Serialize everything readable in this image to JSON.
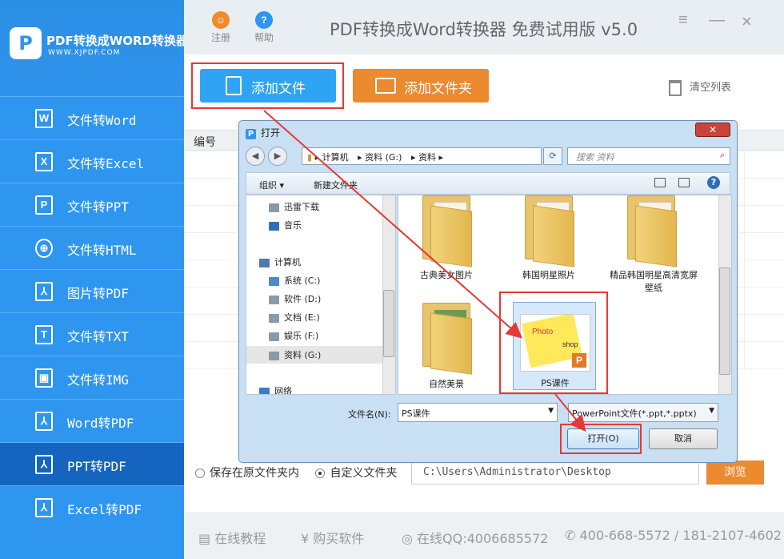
{
  "sidebar": {
    "logo_glyph": "P",
    "title": "PDF转换成WORD转换器",
    "subtitle": "WWW.XJPDF.COM",
    "items": [
      {
        "label": "文件转Word",
        "icon": "word-icon",
        "glyph": "W"
      },
      {
        "label": "文件转Excel",
        "icon": "excel-icon",
        "glyph": "X"
      },
      {
        "label": "文件转PPT",
        "icon": "ppt-icon",
        "glyph": "P"
      },
      {
        "label": "文件转HTML",
        "icon": "globe-icon",
        "glyph": "⊕"
      },
      {
        "label": "图片转PDF",
        "icon": "pdf-icon",
        "glyph": "⅄"
      },
      {
        "label": "文件转TXT",
        "icon": "txt-icon",
        "glyph": "T"
      },
      {
        "label": "文件转IMG",
        "icon": "image-icon",
        "glyph": "▣"
      },
      {
        "label": "Word转PDF",
        "icon": "pdf-icon",
        "glyph": "⅄"
      },
      {
        "label": "PPT转PDF",
        "icon": "pdf-icon",
        "glyph": "⅄"
      },
      {
        "label": "Excel转PDF",
        "icon": "pdf-icon",
        "glyph": "⅄"
      }
    ],
    "active_item": "PPT转PDF"
  },
  "topbar": {
    "register_label": "注册",
    "help_label": "帮助",
    "title": "PDF转换成Word转换器 免费试用版 v5.0",
    "minimize": "≡",
    "dash": "—",
    "close": "×"
  },
  "toolbar": {
    "add_file": "添加文件",
    "add_folder": "添加文件夹",
    "clear_list": "清空列表"
  },
  "table": {
    "col_no": "编号"
  },
  "output": {
    "option_source": "保存在原文件夹内",
    "option_custom": "自定义文件夹",
    "selected": "自定义文件夹",
    "path": "C:\\Users\\Administrator\\Desktop",
    "browse": "浏览"
  },
  "footer": {
    "tutorial": "在线教程",
    "buy": "购买软件",
    "qq": "在线QQ:4006685572",
    "phone": "400-668-5572 / 181-2107-4602"
  },
  "dialog": {
    "title": "打开",
    "close": "✕",
    "address": [
      "计算机",
      "资料 (G:)",
      "资料"
    ],
    "search_placeholder": "搜索 资料",
    "organize": "组织",
    "new_folder": "新建文件夹",
    "nav_items": [
      {
        "label": "迅雷下载",
        "indent": 1
      },
      {
        "label": "音乐",
        "indent": 1
      },
      {
        "label": "计算机",
        "indent": 0
      },
      {
        "label": "系统 (C:)",
        "indent": 1
      },
      {
        "label": "软件 (D:)",
        "indent": 1
      },
      {
        "label": "文档 (E:)",
        "indent": 1
      },
      {
        "label": "娱乐 (F:)",
        "indent": 1
      },
      {
        "label": "资料 (G:)",
        "indent": 1,
        "selected": true
      },
      {
        "label": "网络",
        "indent": 0
      }
    ],
    "files": [
      {
        "name": "古典美女图片",
        "type": "folder"
      },
      {
        "name": "韩国明星照片",
        "type": "folder"
      },
      {
        "name": "精品韩国明星高清宽屏壁纸",
        "type": "folder"
      },
      {
        "name": "自然美景",
        "type": "folder"
      },
      {
        "name": "PS课件",
        "type": "pptx",
        "selected": true
      }
    ],
    "ppt_thumb_text": "Photo",
    "ppt_thumb_text2": "shop",
    "ppt_badge": "P",
    "filename_label": "文件名(N):",
    "filename_value": "PS课件",
    "filetype_value": "PowerPoint文件(*.ppt,*.pptx)",
    "open_button": "打开(O)",
    "cancel_button": "取消"
  },
  "colors": {
    "sidebar": "#2f96ef",
    "sidebar_active": "#1565c0",
    "add_file": "#2fa4f5",
    "add_folder": "#ec8a2f",
    "highlight": "#e53935"
  }
}
